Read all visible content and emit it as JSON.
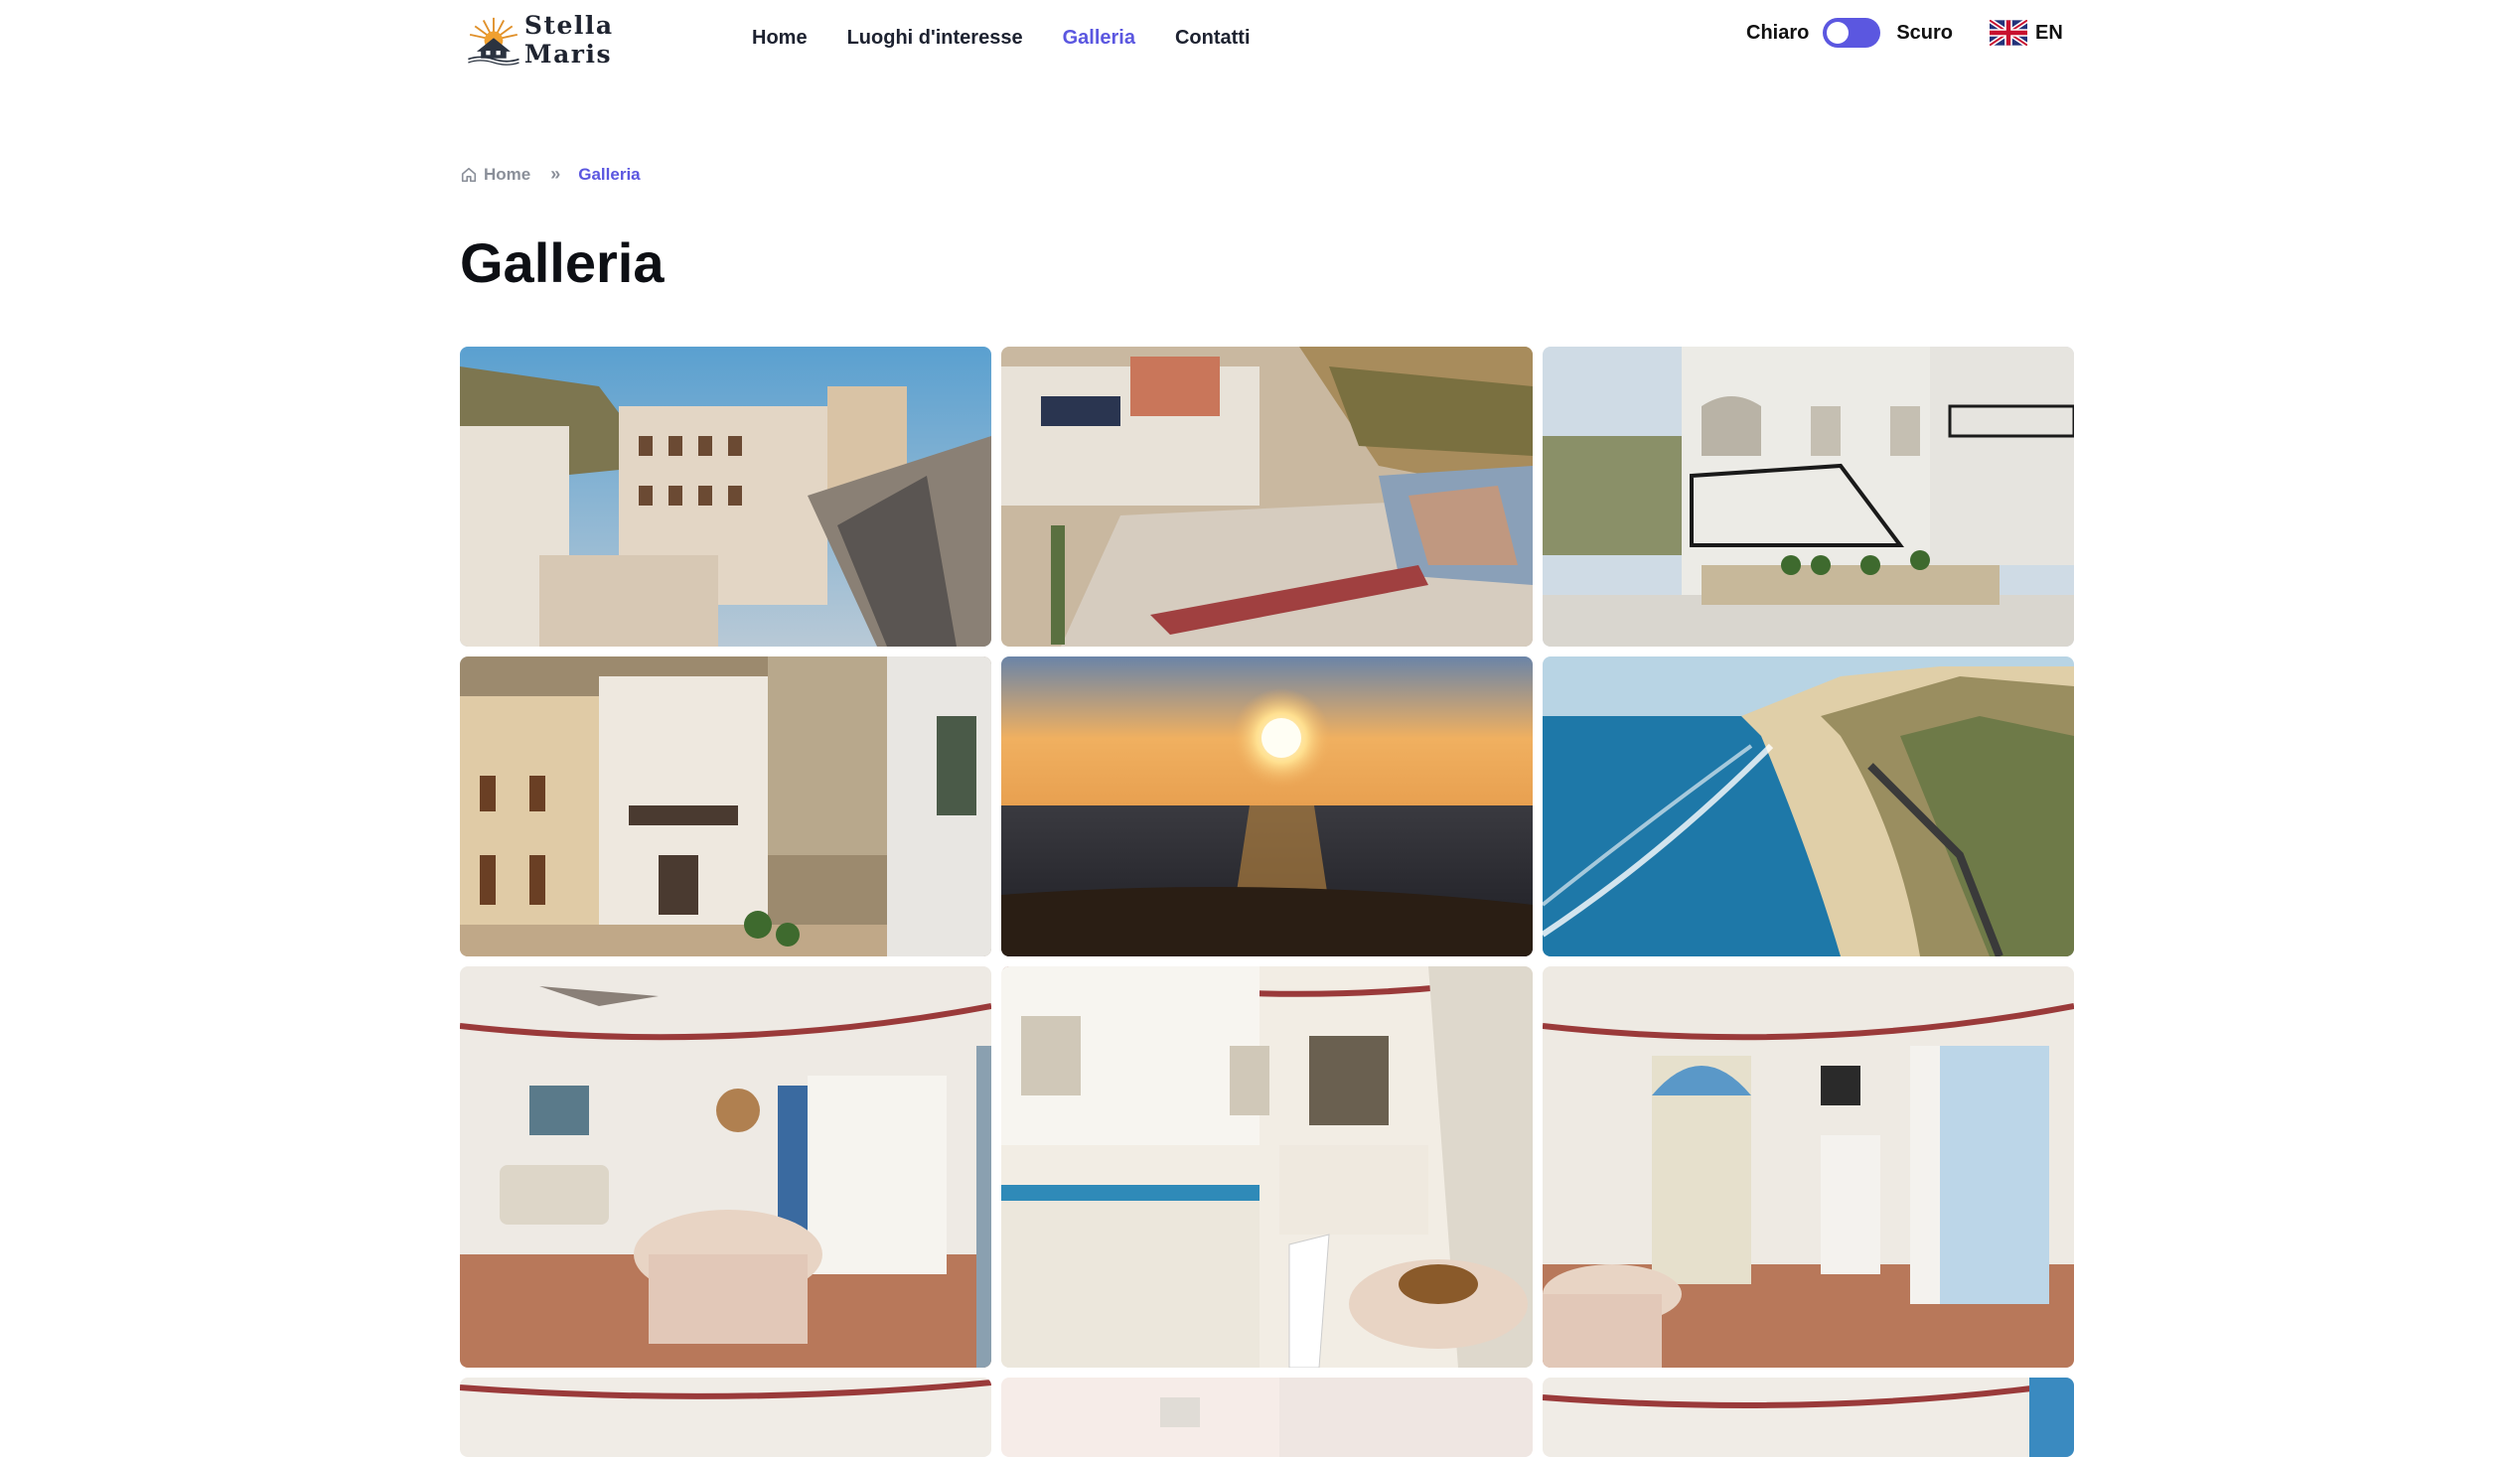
{
  "brand": {
    "name": "Stella Maris"
  },
  "nav": {
    "items": [
      {
        "label": "Home",
        "active": false
      },
      {
        "label": "Luoghi d'interesse",
        "active": false
      },
      {
        "label": "Galleria",
        "active": true
      },
      {
        "label": "Contatti",
        "active": false
      }
    ]
  },
  "theme": {
    "light_label": "Chiaro",
    "dark_label": "Scuro",
    "toggle_on": false
  },
  "language": {
    "code": "EN",
    "flag_icon": "uk-flag-icon"
  },
  "breadcrumb": {
    "home_label": "Home",
    "separator": "»",
    "current_label": "Galleria",
    "home_icon": "home-icon"
  },
  "page": {
    "title": "Galleria"
  },
  "colors": {
    "accent": "#5b57e0",
    "text": "#111111",
    "muted": "#8a8f99"
  },
  "gallery": {
    "photos": [
      {
        "subject": "aerial-building-street"
      },
      {
        "subject": "aerial-rooftop-mural"
      },
      {
        "subject": "white-house-stairs"
      },
      {
        "subject": "building-facades"
      },
      {
        "subject": "sunset-sea"
      },
      {
        "subject": "coast-beach-cliffs"
      },
      {
        "subject": "living-dining-room"
      },
      {
        "subject": "kitchen"
      },
      {
        "subject": "entrance-room-balcony"
      },
      {
        "subject": "interior-partial-1"
      },
      {
        "subject": "interior-partial-2"
      },
      {
        "subject": "interior-partial-3"
      }
    ]
  }
}
